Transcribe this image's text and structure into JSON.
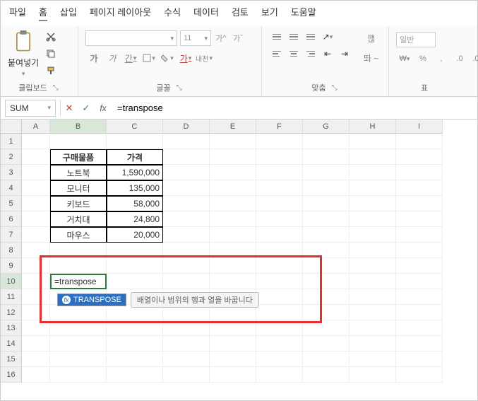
{
  "menu": [
    "파일",
    "홈",
    "삽입",
    "페이지 레이아웃",
    "수식",
    "데이터",
    "검토",
    "보기",
    "도움말"
  ],
  "active_menu_index": 1,
  "ribbon": {
    "clipboard": {
      "label": "클립보드",
      "paste": "붙여넣기"
    },
    "font": {
      "label": "글꼴",
      "size": "11",
      "btns": {
        "bold": "가",
        "italic": "가",
        "under": "간",
        "grow": "가",
        "shrink": "가",
        "hangul": "내천",
        "hangul2": "가"
      }
    },
    "align": {
      "label": "맞춤",
      "wrap": "깮",
      "merge": "똬 ~"
    },
    "number": {
      "label": "표",
      "general": "일반"
    }
  },
  "formula_bar": {
    "name": "SUM",
    "value": "=transpose"
  },
  "columns": [
    "A",
    "B",
    "C",
    "D",
    "E",
    "F",
    "G",
    "H",
    "I"
  ],
  "rows": [
    1,
    2,
    3,
    4,
    5,
    6,
    7,
    8,
    9,
    10,
    11,
    12,
    13,
    14,
    15,
    16
  ],
  "table": {
    "headers": [
      "구매물품",
      "가격"
    ],
    "rows": [
      [
        "노트북",
        "1,590,000"
      ],
      [
        "모니터",
        "135,000"
      ],
      [
        "키보드",
        "58,000"
      ],
      [
        "거치대",
        "24,800"
      ],
      [
        "마우스",
        "20,000"
      ]
    ]
  },
  "active_cell_text": "=transpose",
  "suggestion": {
    "name": "TRANSPOSE",
    "desc": "배열이나 범위의 행과 열을 바꿉니다"
  }
}
